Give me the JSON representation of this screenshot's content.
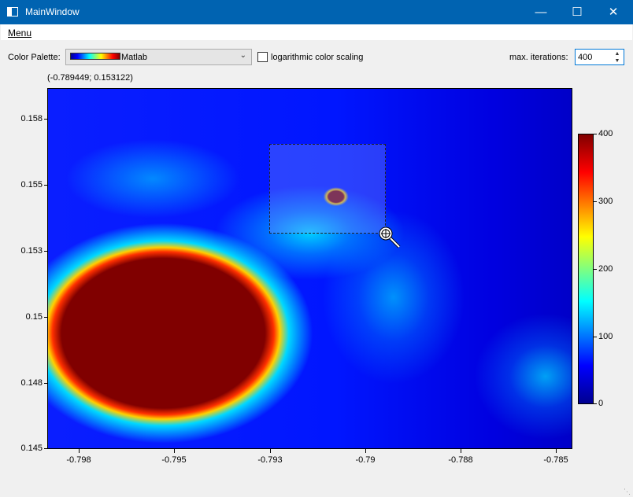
{
  "window": {
    "title": "MainWindow",
    "controls": {
      "minimize": "—",
      "maximize": "☐",
      "close": "✕"
    }
  },
  "menubar": {
    "menu_label": "Menu"
  },
  "toolbar": {
    "color_palette_label": "Color Palette:",
    "color_palette_value": "Matlab",
    "log_scaling_label": "logarithmic color scaling",
    "log_scaling_checked": false,
    "max_iterations_label": "max. iterations:",
    "max_iterations_value": "400"
  },
  "plot": {
    "cursor_coords": "(-0.789449; 0.153122)",
    "y_ticks": [
      "0.158",
      "0.155",
      "0.153",
      "0.15",
      "0.148",
      "0.145"
    ],
    "x_ticks": [
      "-0.798",
      "-0.795",
      "-0.793",
      "-0.79",
      "-0.788",
      "-0.785"
    ],
    "colorbar_ticks": [
      "400",
      "300",
      "200",
      "100",
      "0"
    ],
    "colors": {
      "inside": "#800000",
      "background": "#0000ff",
      "selection": "#7896ff"
    }
  },
  "icons": {
    "app": "window-icon",
    "cursor": "zoom-cursor-icon",
    "dropdown": "chevron-down-icon"
  }
}
